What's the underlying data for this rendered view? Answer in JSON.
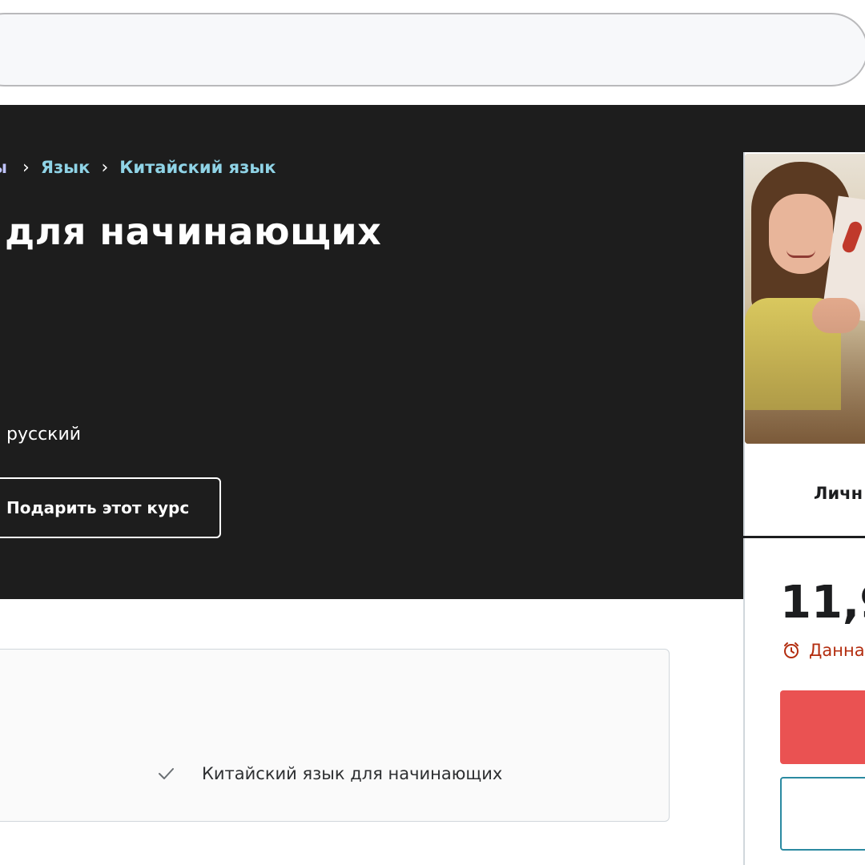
{
  "search": {
    "value": ""
  },
  "breadcrumb": {
    "partial_first": "ы",
    "items": [
      "Язык",
      "Китайский язык"
    ]
  },
  "course": {
    "title_visible": "для начинающих",
    "language_visible": "русский",
    "gift_label": "Подарить этот курс"
  },
  "sidebar": {
    "tab_label_visible": "Личн",
    "price_visible": "11,9",
    "timer_text_visible": "Данна"
  },
  "learn": {
    "items": [
      "Китайский язык для начинающих"
    ]
  },
  "icons": {
    "alarm": "alarm-clock-icon",
    "check": "check-icon",
    "chevron": "chevron-right-icon"
  },
  "colors": {
    "hero_bg": "#1d1d1d",
    "breadcrumb_link": "#c0c4fc",
    "breadcrumb_link_active": "#8fd3e6",
    "buy_button": "#ea5252",
    "timer_text": "#b32d0f",
    "cart_border": "#2b8aa1"
  }
}
